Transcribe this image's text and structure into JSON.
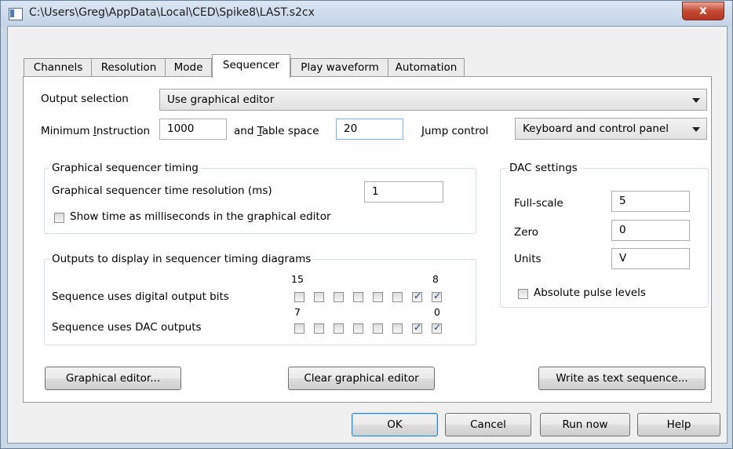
{
  "window": {
    "title": "C:\\Users\\Greg\\AppData\\Local\\CED\\Spike8\\LAST.s2cx",
    "close_glyph": "x"
  },
  "tabs": [
    {
      "label": "Channels",
      "active": false
    },
    {
      "label": "Resolution",
      "active": false
    },
    {
      "label": "Mode",
      "active": false
    },
    {
      "label": "Sequencer",
      "active": true
    },
    {
      "label": "Play waveform",
      "active": false
    },
    {
      "label": "Automation",
      "active": false
    }
  ],
  "output_selection": {
    "label": "Output selection",
    "value": "Use graphical editor"
  },
  "minimum_instruction": {
    "label_pre": "Minimum ",
    "label_key": "I",
    "label_post": "nstruction",
    "value": "1000"
  },
  "table_space": {
    "label_pre": "and ",
    "label_key": "T",
    "label_post": "able space",
    "value": "20"
  },
  "jump_control": {
    "label_key": "J",
    "label_post": "ump control",
    "value": "Keyboard and control panel"
  },
  "timing_group": {
    "title": "Graphical sequencer timing",
    "resolution_label": "Graphical sequencer time resolution (ms)",
    "resolution_value": "1",
    "show_ms_label": "Show time as milliseconds in the graphical editor",
    "show_ms_checked": false
  },
  "outputs_group": {
    "title": "Outputs to display in sequencer timing diagrams",
    "digital_label": "Sequence uses digital output bits",
    "digital_high": "15",
    "digital_low": "8",
    "digital_bits": [
      false,
      false,
      false,
      false,
      false,
      false,
      true,
      true
    ],
    "dac_label": "Sequence uses DAC outputs",
    "dac_high": "7",
    "dac_low": "0",
    "dac_bits": [
      false,
      false,
      false,
      false,
      false,
      false,
      true,
      true
    ]
  },
  "dac_settings": {
    "title": "DAC settings",
    "fullscale_label": "Full-scale",
    "fullscale_value": "5",
    "zero_label": "Zero",
    "zero_value": "0",
    "units_label": "Units",
    "units_value": "V",
    "absolute_label": "Absolute pulse levels",
    "absolute_checked": false
  },
  "panel_buttons": {
    "graphical_editor": "Graphical editor...",
    "clear_editor": "Clear graphical editor",
    "write_text": "Write as text sequence..."
  },
  "dialog_buttons": {
    "ok": "OK",
    "cancel": "Cancel",
    "run_now": "Run now",
    "help": "Help"
  }
}
